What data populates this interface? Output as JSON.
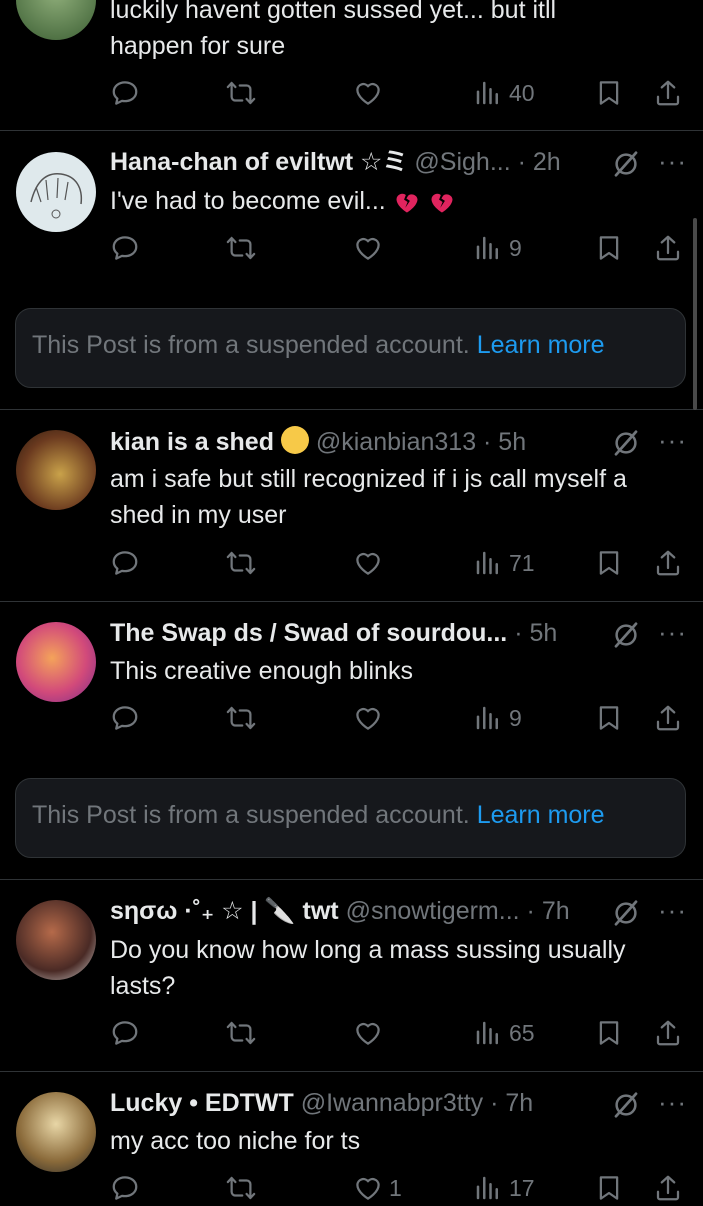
{
  "colors": {
    "background": "#000000",
    "text": "#e7e9ea",
    "muted": "#71767b",
    "link": "#1d9bf0",
    "divider": "#2f3336"
  },
  "tweet0": {
    "text_line1": "luckily havent gotten sussed yet... but itll",
    "text_line2": "happen for sure",
    "views": "40"
  },
  "tweet1": {
    "name": "Hana-chan of eviltwt ☆ミ",
    "handle_time": "@Sigh... · 2h",
    "text": "I've had to become evil...",
    "emoji": [
      "broken-heart",
      "broken-heart"
    ],
    "views": "9"
  },
  "suspended1": {
    "message": "This Post is from a suspended account.",
    "link": "Learn more"
  },
  "tweet2": {
    "name": "kian is a shed",
    "name_emoji": "neutral-face",
    "handle_time": "@kianbian313 · 5h",
    "text_line1": "am i safe but still recognized if i js call myself a",
    "text_line2": "shed in my user",
    "views": "71"
  },
  "tweet3": {
    "name": "The Swap ds / Swad of sourdou...",
    "handle_time": "· 5h",
    "text": "This creative enough blinks",
    "views": "9"
  },
  "suspended2": {
    "message": "This Post is from a suspended account.",
    "link": "Learn more"
  },
  "tweet4": {
    "name": "sησω ·˚₊ ☆ | 🔪 twt",
    "handle_time": "@snowtigerm... · 7h",
    "text_line1": "Do you know how long a mass sussing usually",
    "text_line2": "lasts?",
    "views": "65"
  },
  "tweet5": {
    "name": "Lucky • EDTWT",
    "handle_time": "@Iwannabpr3tty · 7h",
    "text": "my acc too niche for ts",
    "likes": "1",
    "views": "17"
  },
  "icons": [
    "reply-icon",
    "retweet-icon",
    "like-icon",
    "views-icon",
    "bookmark-icon",
    "share-icon",
    "grok-icon",
    "more-icon"
  ]
}
